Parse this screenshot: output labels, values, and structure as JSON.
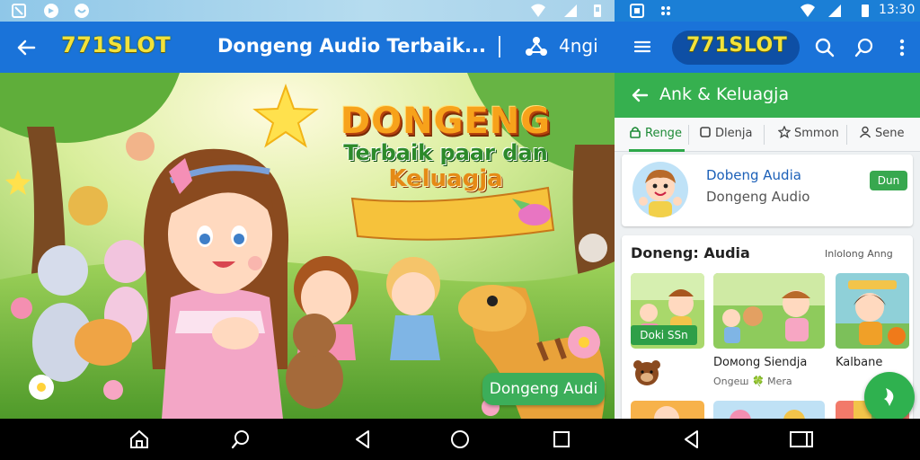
{
  "left": {
    "toolbar": {
      "logo": "771SLOT",
      "title": "Dongeng Audio Terbaik...",
      "lang": "4ngi"
    },
    "banner": {
      "line1": "DONGENG",
      "line2": "Terbaik paar dan",
      "line3": "Keluagja"
    },
    "pill": "Dongeng Audi"
  },
  "right": {
    "status": {
      "time": "13:30"
    },
    "toolbar": {
      "logo": "771SLOT"
    },
    "header": {
      "title": "Ank & Keluagja"
    },
    "tabs": [
      {
        "label": "Renge",
        "icon": "lock-icon",
        "active": true
      },
      {
        "label": "Dlenja",
        "icon": "square-icon",
        "active": false
      },
      {
        "label": "Smmon",
        "icon": "star-icon",
        "active": false
      },
      {
        "label": "Sene",
        "icon": "person-icon",
        "active": false
      }
    ],
    "profile": {
      "name": "Dobeng Audia",
      "subtitle": "Dongeng Audio",
      "button": "Dun"
    },
    "section": {
      "title": "Doneng: Audia",
      "more": "Inlolong Anng",
      "cards": [
        {
          "badge": "Doki SSn"
        },
        {
          "title": "Doмong Siendja",
          "subtitle": "Ongeш 🍀 Mera"
        },
        {
          "title": "Kalbane"
        }
      ]
    }
  },
  "colors": {
    "toolbar_blue": "#1a73d9",
    "accent_green": "#36b04f",
    "logo_yellow": "#f3e23a"
  }
}
